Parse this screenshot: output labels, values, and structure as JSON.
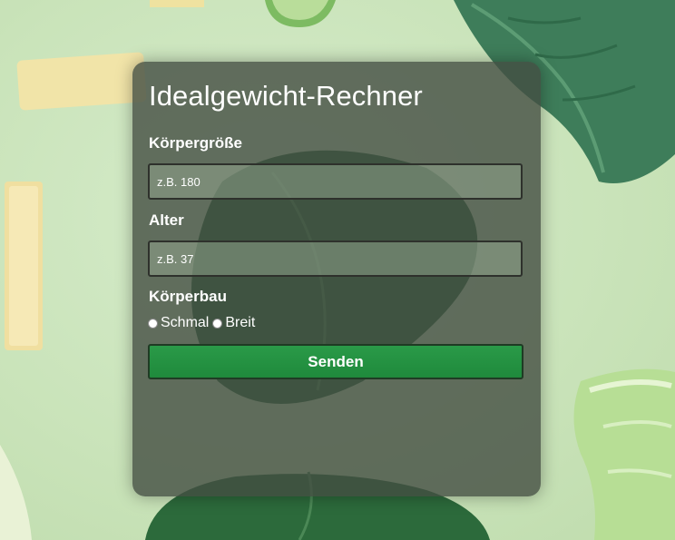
{
  "form": {
    "title": "Idealgewicht-Rechner",
    "height": {
      "label": "Körpergröße",
      "placeholder": "z.B. 180",
      "value": ""
    },
    "age": {
      "label": "Alter",
      "placeholder": "z.B. 37",
      "value": ""
    },
    "build": {
      "label": "Körperbau",
      "options": [
        "Schmal",
        "Breit"
      ],
      "selected": null
    },
    "submit_label": "Senden"
  },
  "colors": {
    "card_background": "#444e42",
    "submit_button": "#1f8a3c",
    "page_background": "#cfe6bf"
  }
}
